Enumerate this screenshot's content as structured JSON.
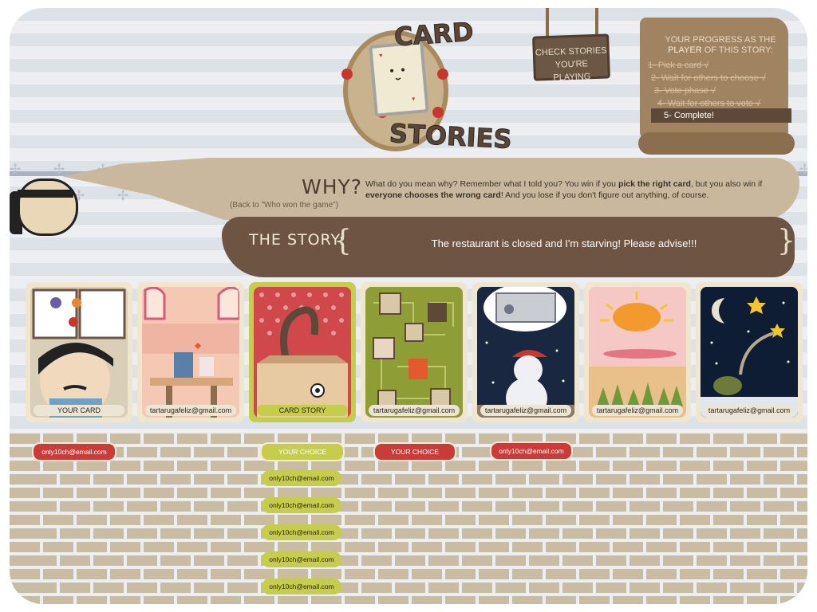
{
  "header": {
    "logo_line1": "CARD",
    "logo_line2": "STORIES",
    "check_stories_label": "CHECK STORIES YOU'RE PLAYING"
  },
  "progress": {
    "title": "YOUR PROGRESS AS THE",
    "title_player": "PLAYER",
    "title_rest": "OF THIS STORY:",
    "steps": [
      "1- Pick a card √",
      "2- Wait for others to choose √",
      "3- Vote phase √",
      "4- Wait for others to vote √"
    ],
    "current_step": "5- Complete!"
  },
  "why": {
    "title": "WHY?",
    "back_link": "(Back to \"Who won the game\")",
    "text_1": "What do you mean why? Remember what I told you? You win if you ",
    "bold_1": "pick the right card",
    "text_2": ", but you also win if ",
    "bold_2": "everyone chooses the wrong card",
    "text_3": "! And you lose if you don't figure out anything, of course."
  },
  "story": {
    "title": "THE STORY:",
    "open_brace": "{",
    "close_brace": "}",
    "text": "The restaurant is closed and I'm starving! Please advise!!!"
  },
  "cards": [
    {
      "label": "YOUR CARD"
    },
    {
      "label": "tartarugafeliz@gmail.com"
    },
    {
      "label": "CARD STORY"
    },
    {
      "label": "tartarugafeliz@gmail.com"
    },
    {
      "label": "tartarugafeliz@gmail.com"
    },
    {
      "label": "tartarugafeliz@gmail.com"
    },
    {
      "label": "tartarugafeliz@gmail.com"
    }
  ],
  "votes": {
    "card_1": "only10ch@email.com",
    "story_choice": "YOUR CHOICE",
    "story_votes": [
      "only10ch@email.com",
      "only10ch@email.com",
      "only10ch@email.com",
      "only10ch@email.com",
      "only10ch@email.com"
    ],
    "card_4_choice": "YOUR CHOICE",
    "card_5": "only10ch@email.com"
  },
  "colors": {
    "brown_dark": "#6d5443",
    "tan": "#c9b89d",
    "accent_yellow": "#c6cc4c",
    "accent_red": "#c93c39"
  }
}
